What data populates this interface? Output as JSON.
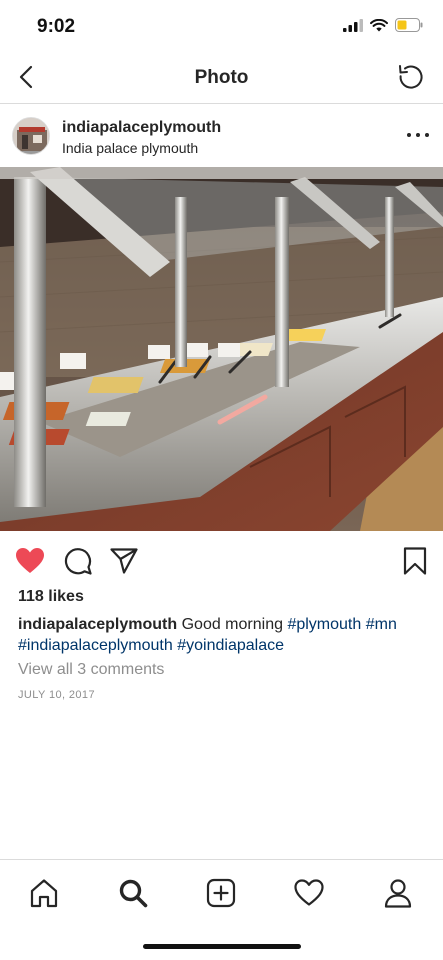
{
  "status_bar": {
    "time": "9:02",
    "icons": [
      "signal-icon",
      "wifi-icon",
      "battery-icon"
    ],
    "battery_color": "#f5c518"
  },
  "nav": {
    "title": "Photo",
    "back_icon": "chevron-left-icon",
    "refresh_icon": "refresh-icon"
  },
  "post": {
    "username": "indiapalaceplymouth",
    "location": "India palace plymouth",
    "more_icon": "more-options-icon",
    "photo_subject": "buffet-photo",
    "likes": "118 likes",
    "caption": {
      "username": "indiapalaceplymouth",
      "text": "Good morning",
      "hashtags": [
        "#plymouth",
        "#mn",
        "#indiapalaceplymouth",
        "#yoindiapalace"
      ]
    },
    "view_comments": "View all 3 comments",
    "date": "JULY 10, 2017"
  },
  "actions": {
    "liked": true,
    "like_color": "#ed4956",
    "icons": [
      "heart-icon",
      "comment-icon",
      "share-icon",
      "bookmark-icon"
    ]
  },
  "tab_bar": {
    "tabs": [
      "home-icon",
      "search-icon",
      "add-post-icon",
      "activity-heart-icon",
      "profile-icon"
    ],
    "active": "search-icon"
  },
  "colors": {
    "text": "#262626",
    "muted": "#8e8e8e",
    "link": "#003569",
    "divider": "#dbdbdb"
  }
}
